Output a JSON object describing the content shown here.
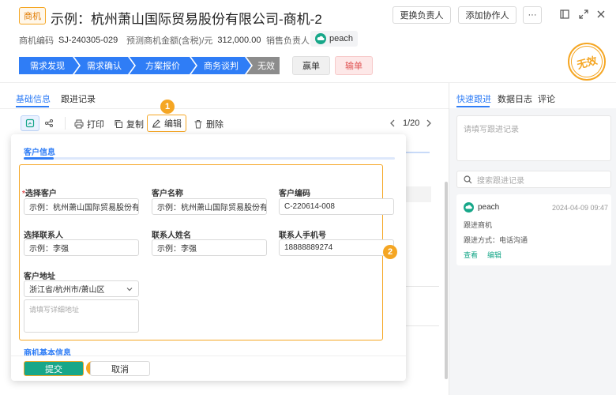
{
  "header": {
    "tag": "商机",
    "title": "示例：杭州萧山国际贸易股份有限公司-商机-2",
    "buttons": {
      "change_owner": "更换负责人",
      "add_collaborator": "添加协作人",
      "more": "···"
    }
  },
  "meta": {
    "code_label": "商机编码",
    "code_value": "SJ-240305-029",
    "amount_label": "预测商机金额(含税)/元",
    "amount_value": "312,000.00",
    "owner_label": "销售负责人",
    "owner_value": "peach"
  },
  "stages": [
    "需求发现",
    "需求确认",
    "方案报价",
    "商务谈判",
    "无效"
  ],
  "stage_buttons": {
    "win": "赢单",
    "lose": "输单"
  },
  "stamp": "无效",
  "tabs": {
    "basic": "基础信息",
    "followup": "跟进记录"
  },
  "toolbar": {
    "print": "打印",
    "copy": "复制",
    "edit": "编辑",
    "delete": "删除",
    "pagination": "1/20"
  },
  "form": {
    "section_title": "客户信息",
    "fields": {
      "select_customer": {
        "label": "选择客户",
        "value": "示例：杭州萧山国际贸易股份有..."
      },
      "customer_name": {
        "label": "客户名称",
        "value": "示例：杭州萧山国际贸易股份有..."
      },
      "customer_code": {
        "label": "客户编码",
        "value": "C-220614-008"
      },
      "select_contact": {
        "label": "选择联系人",
        "value": "示例：李强"
      },
      "contact_name": {
        "label": "联系人姓名",
        "value": "示例：李强"
      },
      "contact_phone": {
        "label": "联系人手机号",
        "value": "18888889274"
      },
      "address": {
        "label": "客户地址",
        "value": "浙江省/杭州市/萧山区",
        "detail_placeholder": "请填写详细地址"
      }
    },
    "basic_section": "商机基本信息",
    "submit": "提交",
    "cancel": "取消"
  },
  "right_panel": {
    "tabs": {
      "quick": "快速跟进",
      "log": "数据日志",
      "comment": "评论"
    },
    "followup_placeholder": "请填写跟进记录",
    "search_placeholder": "搜索跟进记录",
    "record": {
      "user": "peach",
      "time": "2024-04-09 09:47",
      "line1": "跟进商机",
      "line2": "跟进方式：电话沟通",
      "view": "查看",
      "edit": "编辑"
    }
  },
  "annotations": [
    "1",
    "2",
    "3"
  ],
  "colors": {
    "primary": "#2f7df6",
    "teal": "#17a789",
    "orange": "#f5a623",
    "invalid": "#8c8c8c"
  }
}
